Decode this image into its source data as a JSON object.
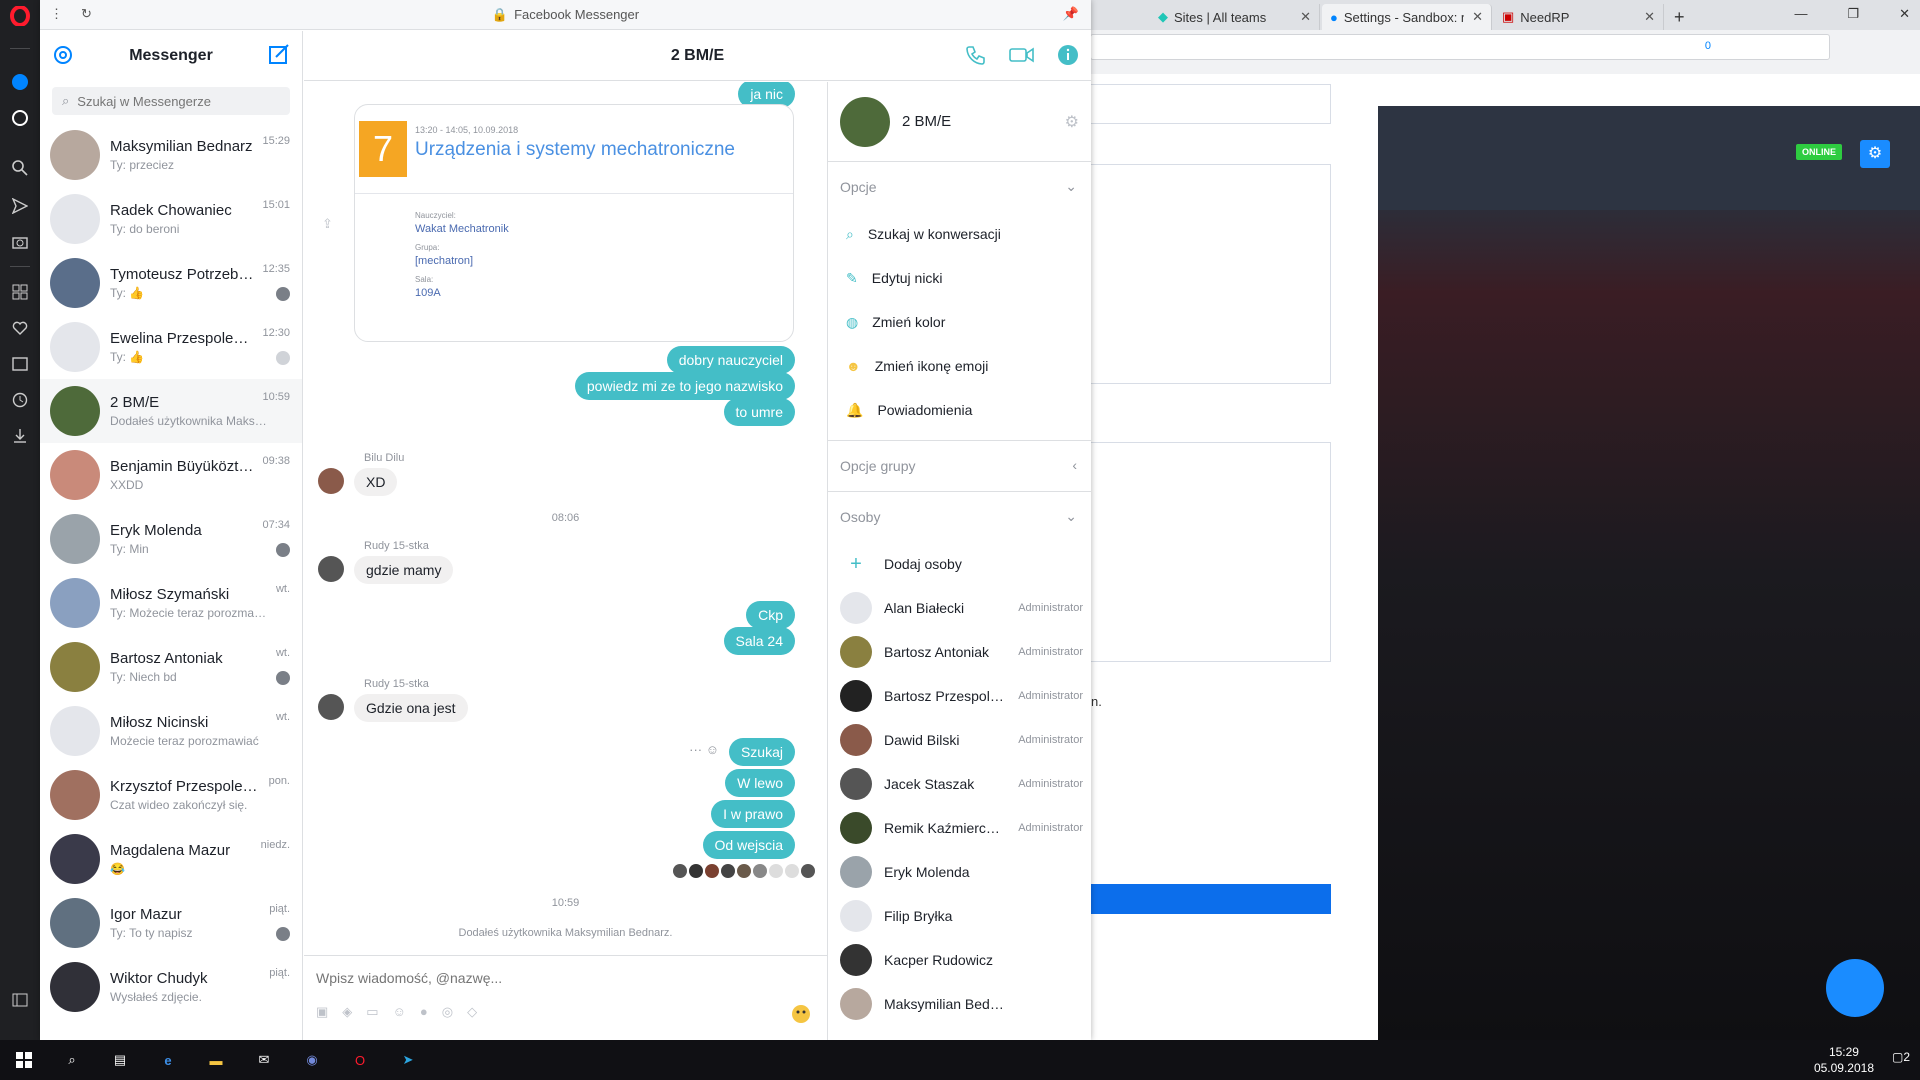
{
  "window": {
    "title": "Facebook Messenger"
  },
  "browser": {
    "tabs": [
      {
        "label": "Sites | All teams",
        "active": false
      },
      {
        "label": "Settings - Sandbox: mast",
        "active": true
      },
      {
        "label": "NeedRP",
        "active": false
      }
    ],
    "badge_count": "0"
  },
  "sidebar": {
    "title": "Messenger",
    "search_placeholder": "Szukaj w Messengerze",
    "conversations": [
      {
        "name": "Maksymilian Bednarz",
        "preview": "Ty: przeciez",
        "time": "15:29"
      },
      {
        "name": "Radek Chowaniec",
        "preview": "Ty: do beroni",
        "time": "15:01"
      },
      {
        "name": "Tymoteusz Potrzebowski",
        "preview": "Ty: 👍",
        "time": "12:35"
      },
      {
        "name": "Ewelina Przespolewska",
        "preview": "Ty: 👍",
        "time": "12:30"
      },
      {
        "name": "2 BM/E",
        "preview": "Dodałeś użytkownika Maksymilian Bednarz.",
        "time": "10:59"
      },
      {
        "name": "Benjamin Büyüköztürk",
        "preview": "XXDD",
        "time": "09:38"
      },
      {
        "name": "Eryk Molenda",
        "preview": "Ty: Min",
        "time": "07:34"
      },
      {
        "name": "Miłosz Szymański",
        "preview": "Ty: Możecie teraz porozmawiać",
        "time": "wt."
      },
      {
        "name": "Bartosz Antoniak",
        "preview": "Ty: Niech bd",
        "time": "wt."
      },
      {
        "name": "Miłosz Nicinski",
        "preview": "Możecie teraz porozmawiać",
        "time": "wt."
      },
      {
        "name": "Krzysztof Przespolewski",
        "preview": "Czat wideo zakończył się.",
        "time": "pon."
      },
      {
        "name": "Magdalena Mazur",
        "preview": "😂",
        "time": "niedz."
      },
      {
        "name": "Igor Mazur",
        "preview": "Ty: To ty napisz",
        "time": "piąt."
      },
      {
        "name": "Wiktor Chudyk",
        "preview": "Wysłałeś zdjęcie.",
        "time": "piąt."
      }
    ]
  },
  "chat": {
    "title": "2 BM/E",
    "card": {
      "number": "7",
      "time": "13:20 - 14:05, 10.09.2018",
      "subject": "Urządzenia i systemy mechatroniczne",
      "teacher_label": "Nauczyciel:",
      "teacher": "Wakat Mechatronik",
      "group_label": "Grupa:",
      "group": "[mechatron]",
      "room_label": "Sala:",
      "room": "109A"
    },
    "messages": {
      "m0": "ja nic",
      "m1": "dobry nauczyciel",
      "m2": "powiedz mi ze to jego nazwisko",
      "m3": "to umre",
      "s1": "Bilu Dilu",
      "m4": "XD",
      "t1": "08:06",
      "s2": "Rudy 15-stka",
      "m5": "gdzie mamy",
      "m6": "Ckp",
      "m7": "Sala 24",
      "s3": "Rudy 15-stka",
      "m8": "Gdzie ona jest",
      "m9": "Szukaj",
      "m10": "W lewo",
      "m11": "I w prawo",
      "m12": "Od wejscia",
      "t2": "10:59",
      "sys": "Dodałeś użytkownika Maksymilian Bednarz."
    },
    "composer_placeholder": "Wpisz wiadomość, @nazwę..."
  },
  "info": {
    "group_name": "2 BM/E",
    "options_header": "Opcje",
    "options": [
      {
        "label": "Szukaj w konwersacji",
        "icon": "search-icon"
      },
      {
        "label": "Edytuj nicki",
        "icon": "pencil-icon"
      },
      {
        "label": "Zmień kolor",
        "icon": "palette-icon"
      },
      {
        "label": "Zmień ikonę emoji",
        "icon": "emoji-icon"
      },
      {
        "label": "Powiadomienia",
        "icon": "bell-icon"
      }
    ],
    "group_options_header": "Opcje grupy",
    "people_header": "Osoby",
    "add_people": "Dodaj osoby",
    "people": [
      {
        "name": "Alan Białecki",
        "role": "Administrator"
      },
      {
        "name": "Bartosz Antoniak",
        "role": "Administrator"
      },
      {
        "name": "Bartosz Przespolewski",
        "role": "Administrator"
      },
      {
        "name": "Dawid Bilski",
        "role": "Administrator"
      },
      {
        "name": "Jacek Staszak",
        "role": "Administrator"
      },
      {
        "name": "Remik Kaźmierczak",
        "role": "Administrator"
      },
      {
        "name": "Eryk Molenda",
        "role": ""
      },
      {
        "name": "Filip Bryłka",
        "role": ""
      },
      {
        "name": "Kacper Rudowicz",
        "role": ""
      },
      {
        "name": "Maksymilian Bednarz",
        "role": ""
      }
    ]
  },
  "bg_page": {
    "status": "ONLINE",
    "text_fragment": "n."
  },
  "taskbar": {
    "time": "15:29",
    "date": "05.09.2018",
    "notif_count": "2"
  },
  "colors": {
    "accent": "#0084ff",
    "bubble": "#44bec7",
    "card_orange": "#f5a623"
  }
}
